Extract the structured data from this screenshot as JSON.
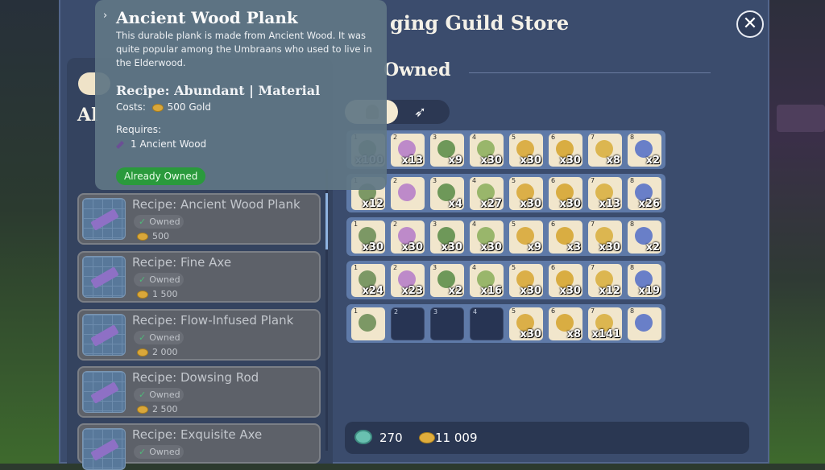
{
  "window": {
    "title": "Foraging Guild Store",
    "title_visible": "ging Guild Store",
    "close_label": "✕"
  },
  "left_panel": {
    "category_label_visible": "Al",
    "items": [
      {
        "name": "Recipe: Ancient Wood Plank",
        "status": "Owned",
        "price": "500"
      },
      {
        "name": "Recipe: Fine Axe",
        "status": "Owned",
        "price": "1 500"
      },
      {
        "name": "Recipe: Flow-Infused Plank",
        "status": "Owned",
        "price": "2 000"
      },
      {
        "name": "Recipe: Dowsing Rod",
        "status": "Owned",
        "price": "2 500"
      },
      {
        "name": "Recipe: Exquisite Axe",
        "status": "Owned",
        "price": ""
      }
    ]
  },
  "tooltip": {
    "title": "Ancient Wood Plank",
    "description": "This durable plank is made from Ancient Wood. It was quite popular among the Umbraans who used to live in the Elderwood.",
    "recipe_line": "Recipe: Abundant | Material",
    "costs_label": "Costs:",
    "costs_value": "500 Gold",
    "requires_label": "Requires:",
    "requires_item": "1 Ancient Wood",
    "badge": "Already Owned"
  },
  "inventory": {
    "title_visible": "Owned",
    "rows": [
      {
        "slots": [
          {
            "i": "1",
            "q": "x100"
          },
          {
            "i": "2",
            "q": "x13"
          },
          {
            "i": "3",
            "q": "x9"
          },
          {
            "i": "4",
            "q": "x30"
          },
          {
            "i": "5",
            "q": "x30"
          },
          {
            "i": "6",
            "q": "x30"
          },
          {
            "i": "7",
            "q": "x8"
          },
          {
            "i": "8",
            "q": "x2"
          }
        ]
      },
      {
        "slots": [
          {
            "i": "1",
            "q": "x12"
          },
          {
            "i": "2",
            "q": ""
          },
          {
            "i": "3",
            "q": "x4"
          },
          {
            "i": "4",
            "q": "x27"
          },
          {
            "i": "5",
            "q": "x30"
          },
          {
            "i": "6",
            "q": "x30"
          },
          {
            "i": "7",
            "q": "x13"
          },
          {
            "i": "8",
            "q": "x26"
          }
        ]
      },
      {
        "slots": [
          {
            "i": "1",
            "q": "x30"
          },
          {
            "i": "2",
            "q": "x30"
          },
          {
            "i": "3",
            "q": "x30"
          },
          {
            "i": "4",
            "q": "x30"
          },
          {
            "i": "5",
            "q": "x9"
          },
          {
            "i": "6",
            "q": "x3"
          },
          {
            "i": "7",
            "q": "x30"
          },
          {
            "i": "8",
            "q": "x2"
          }
        ]
      },
      {
        "slots": [
          {
            "i": "1",
            "q": "x24"
          },
          {
            "i": "2",
            "q": "x23"
          },
          {
            "i": "3",
            "q": "x2"
          },
          {
            "i": "4",
            "q": "x16"
          },
          {
            "i": "5",
            "q": "x30"
          },
          {
            "i": "6",
            "q": "x30"
          },
          {
            "i": "7",
            "q": "x12"
          },
          {
            "i": "8",
            "q": "x19"
          }
        ]
      },
      {
        "slots": [
          {
            "i": "1",
            "q": ""
          },
          {
            "i": "2",
            "q": "",
            "empty": true
          },
          {
            "i": "3",
            "q": "",
            "empty": true
          },
          {
            "i": "4",
            "q": "",
            "empty": true
          },
          {
            "i": "5",
            "q": "x30"
          },
          {
            "i": "6",
            "q": "x8"
          },
          {
            "i": "7",
            "q": "x141"
          },
          {
            "i": "8",
            "q": ""
          }
        ]
      }
    ]
  },
  "currency": {
    "renown": "270",
    "gold": "11 009"
  },
  "colors": {
    "panel": "#3b4c6d",
    "badge_green": "#2a9a3c",
    "gold": "#e0ad3c"
  }
}
